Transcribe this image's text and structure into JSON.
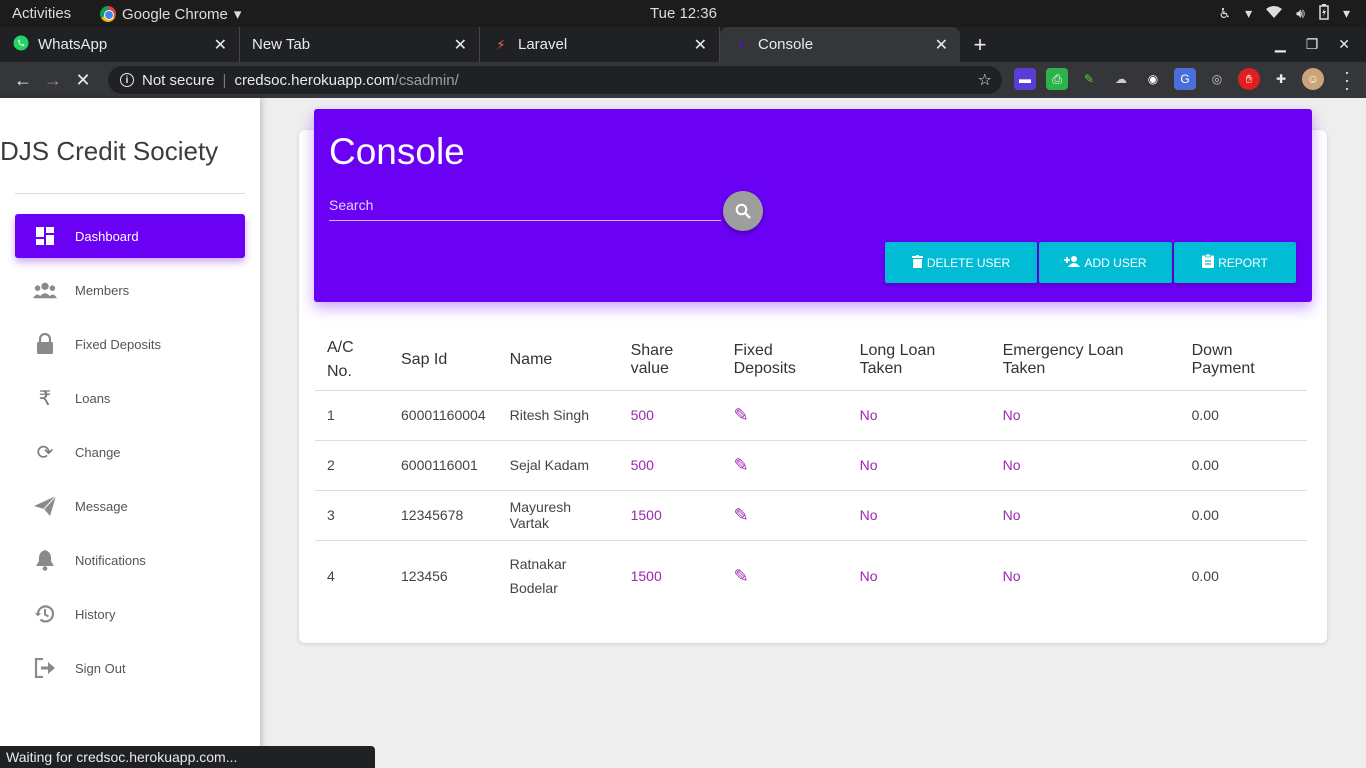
{
  "system": {
    "activities": "Activities",
    "app_name": "Google Chrome",
    "clock": "Tue 12:36"
  },
  "tabs": [
    {
      "label": "WhatsApp",
      "icon": "whatsapp-icon"
    },
    {
      "label": "New Tab",
      "icon": ""
    },
    {
      "label": "Laravel",
      "icon": "laravel-icon"
    },
    {
      "label": "Console",
      "icon": "dot-icon",
      "active": true
    }
  ],
  "omnibox": {
    "security": "Not secure",
    "host": "credsoc.herokuapp.com",
    "path": "/csadmin/"
  },
  "sidebar": {
    "brand": "DJS Credit Society",
    "items": [
      {
        "label": "Dashboard",
        "icon": "dashboard-icon",
        "active": true
      },
      {
        "label": "Members",
        "icon": "group-icon"
      },
      {
        "label": "Fixed Deposits",
        "icon": "lock-icon"
      },
      {
        "label": "Loans",
        "icon": "rupee-icon"
      },
      {
        "label": "Change",
        "icon": "sync-icon"
      },
      {
        "label": "Message",
        "icon": "send-icon"
      },
      {
        "label": "Notifications",
        "icon": "bell-icon"
      },
      {
        "label": "History",
        "icon": "history-icon"
      },
      {
        "label": "Sign Out",
        "icon": "exit-icon"
      }
    ]
  },
  "console": {
    "title": "Console",
    "search_placeholder": "Search",
    "buttons": {
      "delete": "DELETE USER",
      "add": "ADD USER",
      "report": "REPORT"
    }
  },
  "table": {
    "headers": [
      "A/C No.",
      "Sap Id",
      "Name",
      "Share value",
      "Fixed Deposits",
      "Long Loan Taken",
      "Emergency Loan Taken",
      "Down Payment"
    ],
    "rows": [
      {
        "ac": "1",
        "sap": "60001160004",
        "name": "Ritesh Singh",
        "share": "500",
        "long_loan": "No",
        "emergency_loan": "No",
        "down_payment": "0.00"
      },
      {
        "ac": "2",
        "sap": "6000116001",
        "name": "Sejal Kadam",
        "share": "500",
        "long_loan": "No",
        "emergency_loan": "No",
        "down_payment": "0.00"
      },
      {
        "ac": "3",
        "sap": "12345678",
        "name": "Mayuresh Vartak",
        "share": "1500",
        "long_loan": "No",
        "emergency_loan": "No",
        "down_payment": "0.00"
      },
      {
        "ac": "4",
        "sap": "123456",
        "name": "Ratnakar Bodelar",
        "share": "1500",
        "long_loan": "No",
        "emergency_loan": "No",
        "down_payment": "0.00"
      }
    ]
  },
  "status_bar": "Waiting for credsoc.herokuapp.com...",
  "colors": {
    "primary": "#6a00f4",
    "accent": "#00bcd4",
    "link": "#9c27b0"
  }
}
